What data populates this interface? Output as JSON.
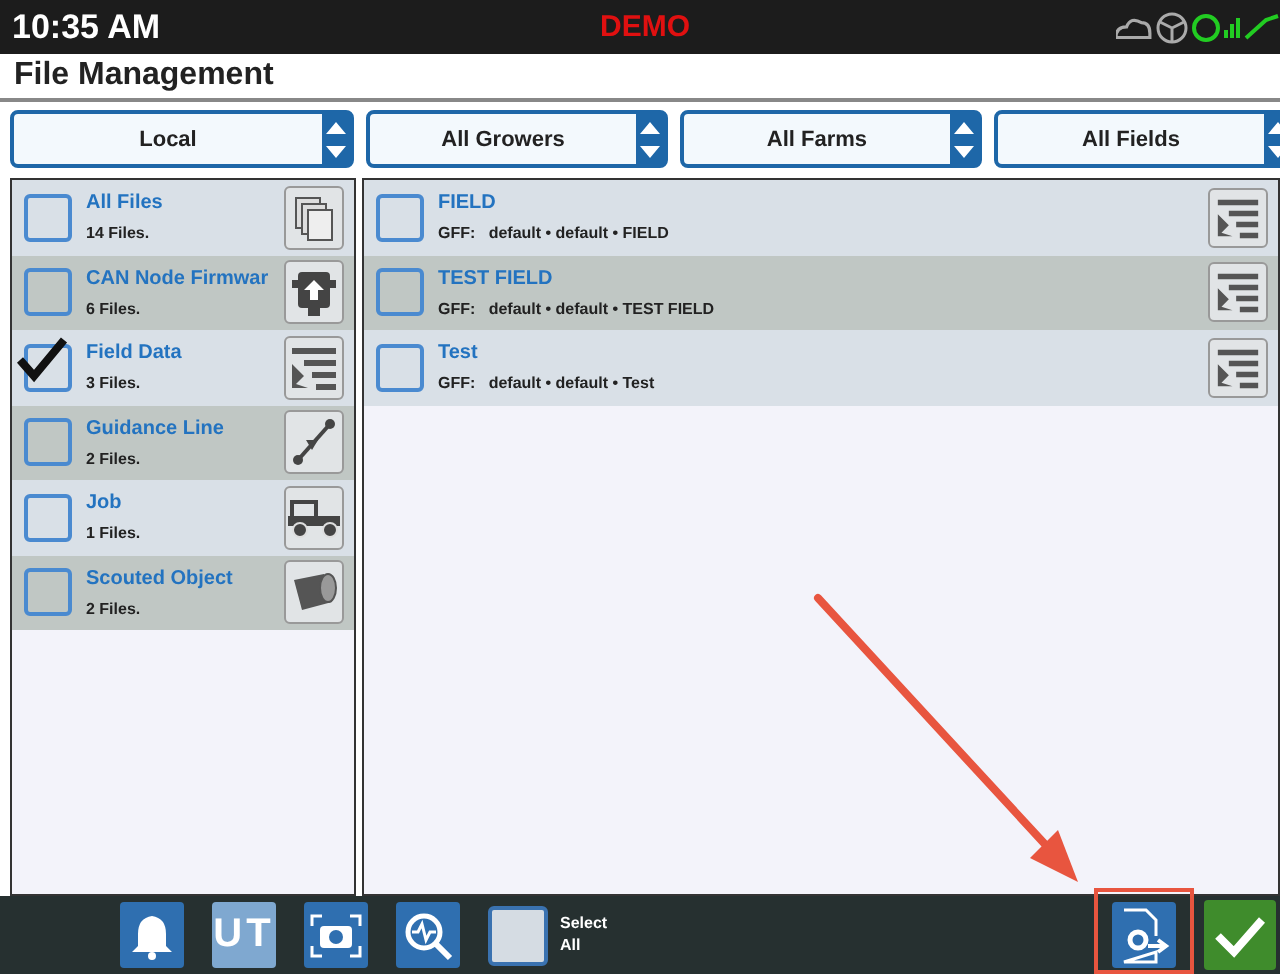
{
  "status_bar": {
    "time": "10:35 AM",
    "mode": "DEMO"
  },
  "title": "File Management",
  "filters": [
    {
      "label": "Local"
    },
    {
      "label": "All Growers"
    },
    {
      "label": "All Farms"
    },
    {
      "label": "All Fields"
    }
  ],
  "categories": [
    {
      "name": "All Files",
      "count": "14 Files.",
      "checked": false,
      "kind": "copies"
    },
    {
      "name": "CAN Node Firmwar",
      "count": "6 Files.",
      "checked": false,
      "kind": "upload"
    },
    {
      "name": "Field Data",
      "count": "3 Files.",
      "checked": true,
      "kind": "field"
    },
    {
      "name": "Guidance Line",
      "count": "2 Files.",
      "checked": false,
      "kind": "line"
    },
    {
      "name": "Job",
      "count": "1 Files.",
      "checked": false,
      "kind": "tractor"
    },
    {
      "name": "Scouted Object",
      "count": "2 Files.",
      "checked": false,
      "kind": "cylinder"
    }
  ],
  "files": [
    {
      "name": "FIELD",
      "format": "GFF:",
      "details": "default • default • FIELD",
      "checked": false
    },
    {
      "name": "TEST FIELD",
      "format": "GFF:",
      "details": "default • default • TEST FIELD",
      "checked": false
    },
    {
      "name": "Test",
      "format": "GFF:",
      "details": "default • default • Test",
      "checked": false
    }
  ],
  "toolbar": {
    "ut_label": "UT",
    "select_all": {
      "label": "Select All",
      "checked": false
    }
  }
}
